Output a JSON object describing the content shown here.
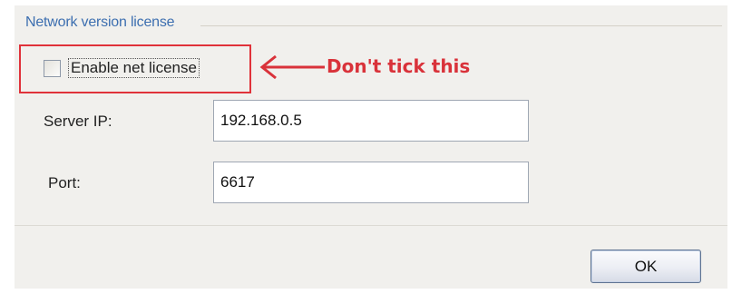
{
  "group": {
    "title": "Network version license"
  },
  "checkbox": {
    "label": "Enable net license",
    "checked": false
  },
  "annotation": {
    "text": "Don't tick this",
    "color": "#d9323a"
  },
  "fields": {
    "server_ip": {
      "label": "Server IP:",
      "value": "192.168.0.5"
    },
    "port": {
      "label": "Port:",
      "value": "6617"
    }
  },
  "buttons": {
    "ok_label": "OK"
  }
}
